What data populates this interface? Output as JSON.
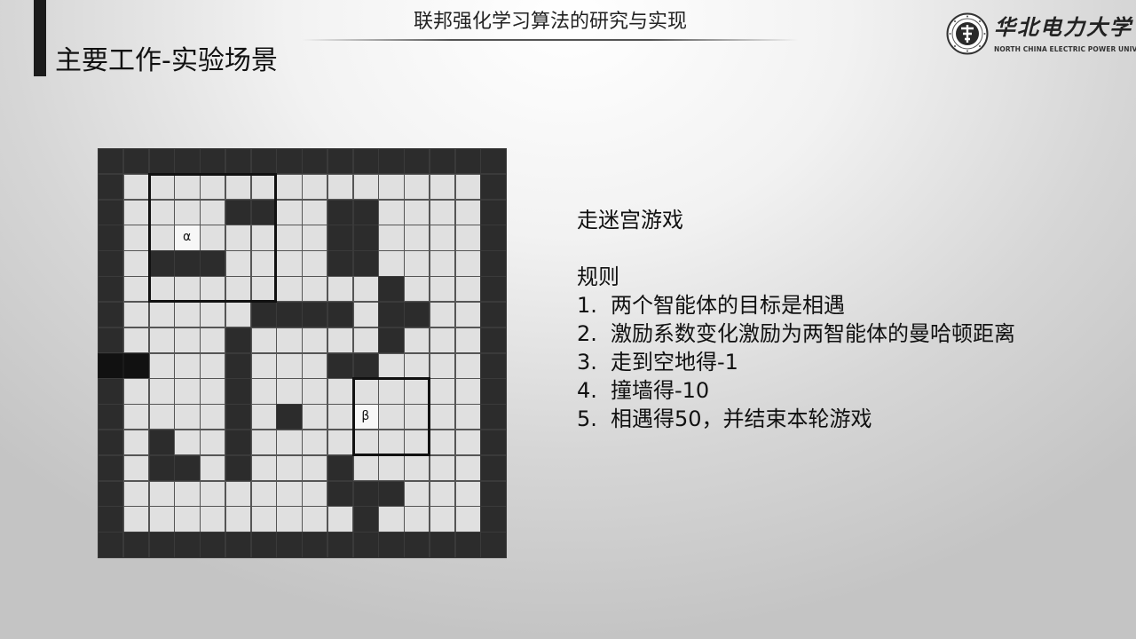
{
  "header": {
    "title": "联邦强化学习算法的研究与实现"
  },
  "slide": {
    "title": "主要工作-实验场景"
  },
  "logo": {
    "name_cn": "华北电力大学",
    "name_en": "NORTH CHINA ELECTRIC POWER UNIVERSITY"
  },
  "colors": {
    "wall": "#2c2c2c",
    "floor": "#e0e0e0",
    "dark_wall": "#111111",
    "agent_cell": "#f7f7f7",
    "accent": "#1b1b1b"
  },
  "maze": {
    "rows": [
      "################",
      "#..............#",
      "#....##..##....#",
      "#..a.....##....#",
      "#.###....##....#",
      "#..........#...#",
      "#.....####.##..#",
      "#....#.....#...#",
      "DD...#...##....#",
      "#....#.........#",
      "#....#.#..b....#",
      "#.#..#.........#",
      "#.##.#...#.....#",
      "#........###...#",
      "#.........#....#",
      "################"
    ],
    "agents": [
      {
        "symbol": "α",
        "name": "agent-alpha"
      },
      {
        "symbol": "β",
        "name": "agent-beta"
      }
    ]
  },
  "rules": {
    "game_title": "走迷宫游戏",
    "heading": "规则",
    "items": [
      {
        "num": "1.",
        "text": "两个智能体的目标是相遇"
      },
      {
        "num": "2.",
        "text": "激励系数变化激励为两智能体的曼哈顿距离"
      },
      {
        "num": "3.",
        "text": "走到空地得-1"
      },
      {
        "num": "4.",
        "text": "撞墙得-10"
      },
      {
        "num": "5.",
        "text": "相遇得50，并结束本轮游戏"
      }
    ]
  }
}
